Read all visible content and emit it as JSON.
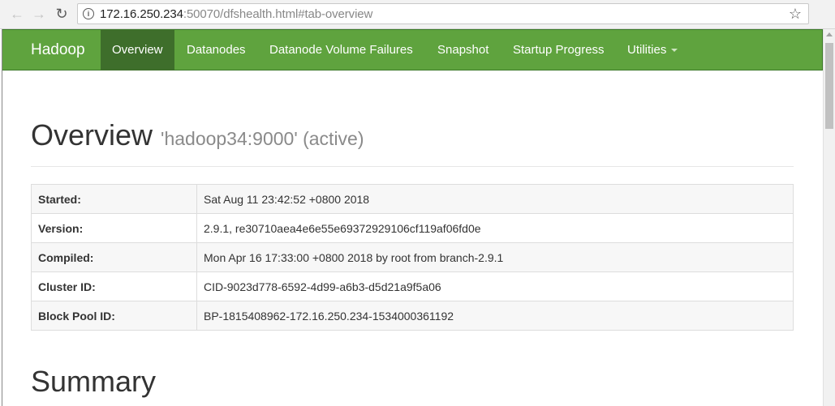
{
  "browser": {
    "back_icon": "arrow-left-icon",
    "forward_icon": "arrow-right-icon",
    "reload_icon": "reload-icon",
    "info_icon": "info-icon",
    "bookmark_icon": "star-icon",
    "url_host": "172.16.250.234",
    "url_rest": ":50070/dfshealth.html#tab-overview"
  },
  "navbar": {
    "brand": "Hadoop",
    "color": "#5fa33e",
    "active_color": "#3e6e2b",
    "items": [
      {
        "label": "Overview",
        "active": true
      },
      {
        "label": "Datanodes"
      },
      {
        "label": "Datanode Volume Failures"
      },
      {
        "label": "Snapshot"
      },
      {
        "label": "Startup Progress"
      },
      {
        "label": "Utilities",
        "dropdown": true
      }
    ]
  },
  "overview": {
    "title": "Overview",
    "subtitle": "'hadoop34:9000' (active)",
    "rows": [
      {
        "label": "Started:",
        "value": "Sat Aug 11 23:42:52 +0800 2018"
      },
      {
        "label": "Version:",
        "value": "2.9.1, re30710aea4e6e55e69372929106cf119af06fd0e"
      },
      {
        "label": "Compiled:",
        "value": "Mon Apr 16 17:33:00 +0800 2018 by root from branch-2.9.1"
      },
      {
        "label": "Cluster ID:",
        "value": "CID-9023d778-6592-4d99-a6b3-d5d21a9f5a06"
      },
      {
        "label": "Block Pool ID:",
        "value": "BP-1815408962-172.16.250.234-1534000361192"
      }
    ]
  },
  "summary": {
    "title": "Summary"
  }
}
